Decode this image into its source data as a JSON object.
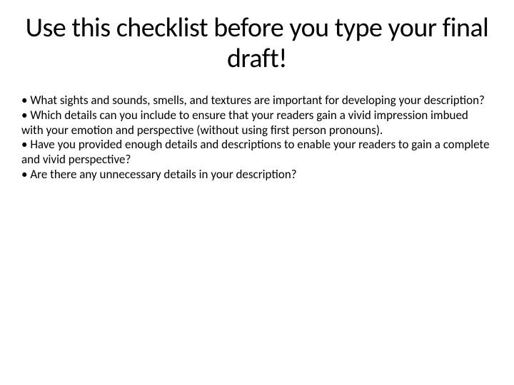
{
  "title": "Use this checklist before you type your final draft!",
  "bullets": [
    "What sights and sounds, smells, and textures  are important for developing your description?",
    "Which details can you include to ensure that your readers gain a vivid impression imbued with your emotion and perspective (without using first person pronouns).",
    "Have you provided enough details and descriptions to enable your readers to gain a complete and vivid perspective?",
    "Are there any unnecessary details in your description?"
  ]
}
